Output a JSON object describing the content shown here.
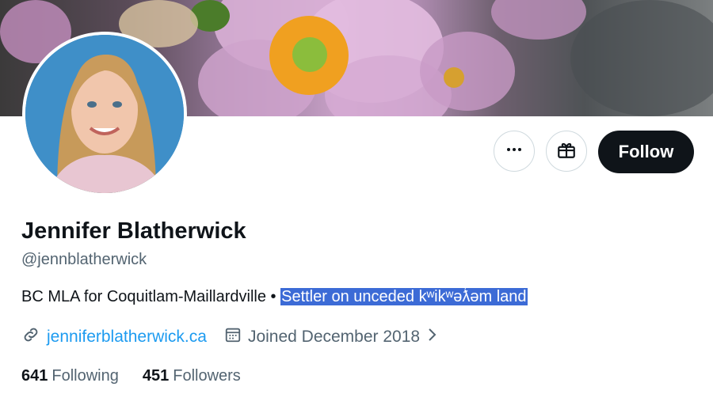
{
  "profile": {
    "name": "Jennifer Blatherwick",
    "handle": "@jennblatherwick",
    "bio_prefix": "BC MLA for Coquitlam-Maillardville • ",
    "bio_highlighted": "Settler on unceded kʷikʷəƛ̓əm land",
    "website": "jenniferblatherwick.ca",
    "joined": "Joined December 2018",
    "following_count": "641",
    "following_label": "Following",
    "followers_count": "451",
    "followers_label": "Followers"
  },
  "actions": {
    "follow_label": "Follow",
    "more_icon": "more-icon",
    "gift_icon": "gift-icon"
  },
  "colors": {
    "link": "#1d9bf0",
    "secondary_text": "#536471",
    "highlight": "#3c6bd6",
    "follow_bg": "#0f1419"
  }
}
